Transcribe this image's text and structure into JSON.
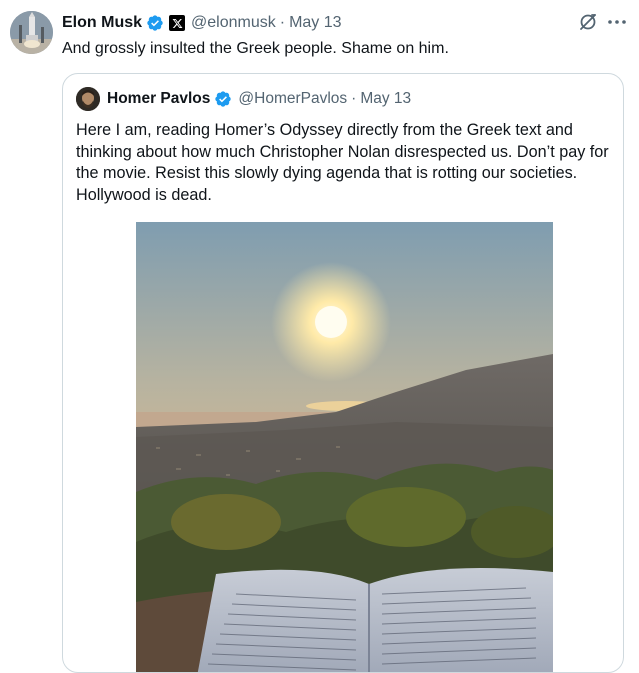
{
  "tweet": {
    "author_name": "Elon Musk",
    "author_handle": "@elonmusk",
    "separator": "·",
    "date": "May 13",
    "text": "And grossly insulted the Greek people. Shame on him."
  },
  "quoted_tweet": {
    "author_name": "Homer Pavlos",
    "author_handle": "@HomerPavlos",
    "separator": "·",
    "date": "May 13",
    "text": "Here I am, reading Homer’s Odyssey directly from the Greek text and thinking about how much Christopher Nolan disrespected us. Don’t pay for the movie. Resist this slowly dying agenda that is rotting our societies. Hollywood is dead."
  },
  "icons": {
    "verified": "verified-badge-icon",
    "affiliate": "x-logo-icon",
    "grok": "grok-icon",
    "more": "more-options-icon"
  },
  "colors": {
    "verified_blue": "#1d9bf0",
    "secondary_text": "#536471",
    "primary_text": "#0f1419",
    "border": "#cfd9de"
  }
}
